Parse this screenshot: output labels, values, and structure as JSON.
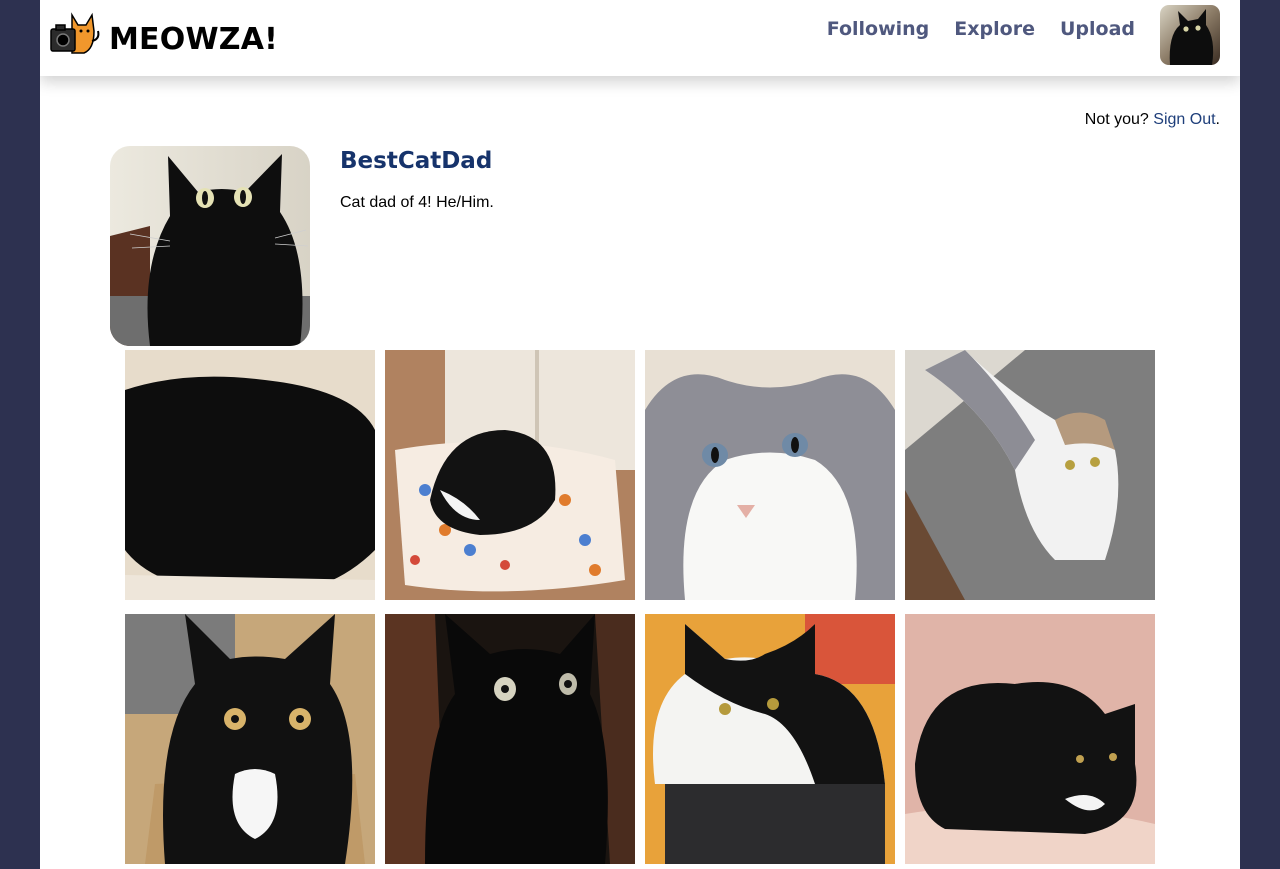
{
  "brand": {
    "name": "MEOWZA!",
    "logo_icon": "cat-camera-logo-icon",
    "accent_color": "#f0972c"
  },
  "nav": {
    "links": [
      {
        "label": "Following"
      },
      {
        "label": "Explore"
      },
      {
        "label": "Upload"
      }
    ],
    "avatar_icon": "user-avatar-icon"
  },
  "session": {
    "prompt": "Not you?",
    "signout_label": "Sign Out",
    "suffix": "."
  },
  "profile": {
    "username": "BestCatDad",
    "bio": "Cat dad of 4! He/Him."
  },
  "gallery": {
    "photos": [
      {
        "subject": "black cat sleeping on cream blanket"
      },
      {
        "subject": "tuxedo cat on paw-print cushion"
      },
      {
        "subject": "grey and white cat close-up"
      },
      {
        "subject": "grey and white cat on carpet"
      },
      {
        "subject": "tuxedo cat in cardboard box"
      },
      {
        "subject": "black cat in dark room"
      },
      {
        "subject": "black and white cat on bag"
      },
      {
        "subject": "black cat on pink sheet"
      }
    ]
  },
  "colors": {
    "background": "#2d3150",
    "nav_link": "#4f587e",
    "username": "#16336b",
    "link": "#1e3e7a"
  }
}
